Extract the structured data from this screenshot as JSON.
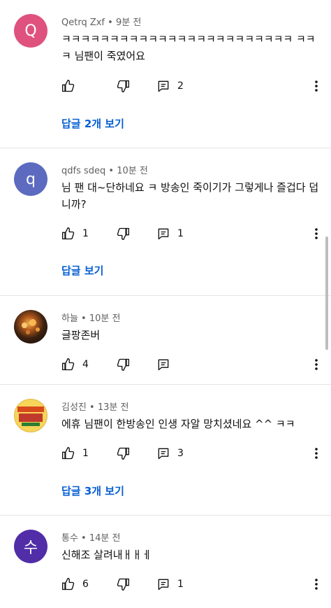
{
  "comments": [
    {
      "author": "Qetrq Zxf",
      "time": "9분 전",
      "avatar_letter": "Q",
      "avatar_color": "#e0527e",
      "text": "ㅋㅋㅋㅋㅋㅋㅋㅋㅋㅋㅋㅋㅋㅋㅋㅋㅋㅋㅋㅋㅋㅋㅋㅋ ㅋㅋㅋ 님팬이 죽였어요",
      "likes": "",
      "replies_count": "2",
      "view_replies": "답글 2개 보기"
    },
    {
      "author": "qdfs sdeq",
      "time": "10분 전",
      "avatar_letter": "q",
      "avatar_color": "#5c6bc0",
      "text": "님 팬 대~단하네요 ㅋ 방송인 죽이기가 그렇게나 즐겁다 덥니까?",
      "likes": "1",
      "replies_count": "1",
      "view_replies": "답글 보기"
    },
    {
      "author": "하늘",
      "time": "10분 전",
      "avatar_letter": "",
      "avatar_color": "#1a1410",
      "text": "글팡존버",
      "likes": "4",
      "replies_count": "",
      "view_replies": ""
    },
    {
      "author": "김성진",
      "time": "13분 전",
      "avatar_letter": "",
      "avatar_color": "#f6d55a",
      "text": "에휴 님팬이 한방송인 인생 자알 망치셨네요 ^^ ㅋㅋ",
      "likes": "1",
      "replies_count": "3",
      "view_replies": "답글 3개 보기"
    },
    {
      "author": "통수",
      "time": "14분 전",
      "avatar_letter": "수",
      "avatar_color": "#512da8",
      "text": "신해조 살려내ㅐㅐㅔ",
      "likes": "6",
      "replies_count": "1",
      "view_replies": ""
    }
  ],
  "icons": {
    "like": "thumbs-up-icon",
    "dislike": "thumbs-down-icon",
    "reply": "comment-icon",
    "more": "more-vertical-icon"
  },
  "colors": {
    "link": "#065fd4",
    "meta": "#606060",
    "divider": "#e5e5e5"
  }
}
